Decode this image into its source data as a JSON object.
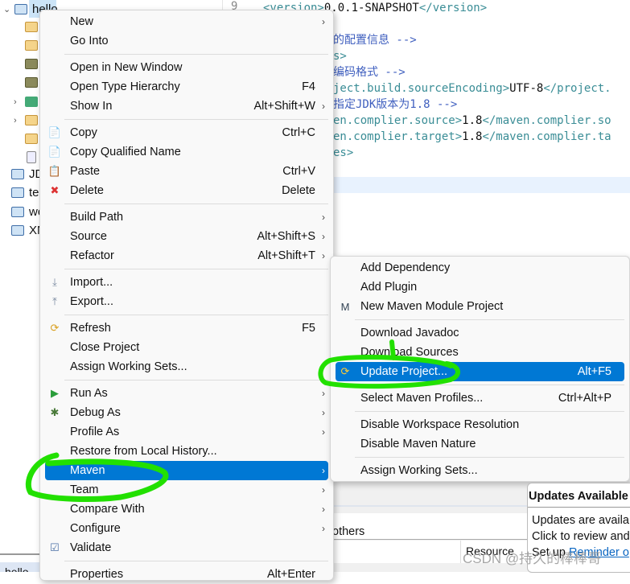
{
  "tree": {
    "items": [
      {
        "label": "hello",
        "selected": true
      },
      {
        "label": "JD"
      },
      {
        "label": "te"
      },
      {
        "label": "wo"
      },
      {
        "label": "XN"
      }
    ],
    "bottom_label": "hello"
  },
  "editor": {
    "line_number": "9",
    "lines": [
      {
        "parts": [
          [
            "tag",
            "<version>"
          ],
          [
            "txt",
            "0.0.1-SNAPSHOT"
          ],
          [
            "tag",
            "</version>"
          ]
        ]
      },
      {
        "parts": [
          [
            "cmt",
            "的配置信息 -->"
          ]
        ]
      },
      {
        "parts": [
          [
            "tag",
            "s>"
          ]
        ]
      },
      {
        "parts": [
          [
            "cmt",
            "  编码格式 -->"
          ]
        ]
      },
      {
        "parts": [
          [
            "tag",
            "ject.build.sourceEncoding>"
          ],
          [
            "txt",
            "UTF-8"
          ],
          [
            "tag",
            "</project."
          ]
        ]
      },
      {
        "parts": [
          [
            "cmt",
            "  指定JDK版本为1.8 -->"
          ]
        ]
      },
      {
        "parts": [
          [
            "tag",
            "en.complier.source>"
          ],
          [
            "txt",
            "1.8"
          ],
          [
            "tag",
            "</maven.complier.so"
          ]
        ]
      },
      {
        "parts": [
          [
            "tag",
            "en.complier.target>"
          ],
          [
            "txt",
            "1.8"
          ],
          [
            "tag",
            "</maven.complier.ta"
          ]
        ]
      },
      {
        "parts": [
          [
            "tag",
            "es>"
          ]
        ]
      }
    ]
  },
  "context_menu": {
    "items": [
      {
        "label": "New",
        "submenu": true
      },
      {
        "label": "Go Into"
      },
      {
        "sep": true
      },
      {
        "label": "Open in New Window"
      },
      {
        "label": "Open Type Hierarchy",
        "shortcut": "F4"
      },
      {
        "label": "Show In",
        "shortcut": "Alt+Shift+W",
        "submenu": true
      },
      {
        "sep": true
      },
      {
        "label": "Copy",
        "shortcut": "Ctrl+C",
        "icon": "copy-icon"
      },
      {
        "label": "Copy Qualified Name",
        "icon": "copy-qualified-name-icon"
      },
      {
        "label": "Paste",
        "shortcut": "Ctrl+V",
        "icon": "paste-icon"
      },
      {
        "label": "Delete",
        "shortcut": "Delete",
        "icon": "delete-icon"
      },
      {
        "sep": true
      },
      {
        "label": "Build Path",
        "submenu": true
      },
      {
        "label": "Source",
        "shortcut": "Alt+Shift+S",
        "submenu": true
      },
      {
        "label": "Refactor",
        "shortcut": "Alt+Shift+T",
        "submenu": true
      },
      {
        "sep": true
      },
      {
        "label": "Import...",
        "icon": "import-icon"
      },
      {
        "label": "Export...",
        "icon": "export-icon"
      },
      {
        "sep": true
      },
      {
        "label": "Refresh",
        "shortcut": "F5",
        "icon": "refresh-icon"
      },
      {
        "label": "Close Project"
      },
      {
        "label": "Assign Working Sets..."
      },
      {
        "sep": true
      },
      {
        "label": "Run As",
        "submenu": true,
        "icon": "run-icon"
      },
      {
        "label": "Debug As",
        "submenu": true,
        "icon": "debug-bug-icon"
      },
      {
        "label": "Profile As",
        "submenu": true
      },
      {
        "label": "Restore from Local History..."
      },
      {
        "label": "Maven",
        "submenu": true,
        "highlighted": true
      },
      {
        "label": "Team",
        "submenu": true
      },
      {
        "label": "Compare With",
        "submenu": true
      },
      {
        "label": "Configure",
        "submenu": true
      },
      {
        "label": "Validate",
        "icon": "checkbox-icon"
      },
      {
        "sep": true
      },
      {
        "label": "Properties",
        "shortcut": "Alt+Enter"
      }
    ]
  },
  "maven_submenu": {
    "items": [
      {
        "label": "Add Dependency"
      },
      {
        "label": "Add Plugin"
      },
      {
        "label": "New Maven Module Project",
        "icon": "maven-module-icon"
      },
      {
        "sep": true
      },
      {
        "label": "Download Javadoc"
      },
      {
        "label": "Download Sources"
      },
      {
        "label": "Update Project...",
        "shortcut": "Alt+F5",
        "highlighted": true,
        "icon": "maven-update-icon"
      },
      {
        "sep": true
      },
      {
        "label": "Select Maven Profiles...",
        "shortcut": "Ctrl+Alt+P"
      },
      {
        "sep": true
      },
      {
        "label": "Disable Workspace Resolution"
      },
      {
        "label": "Disable Maven Nature"
      },
      {
        "sep": true
      },
      {
        "label": "Assign Working Sets..."
      }
    ]
  },
  "bottom_panel": {
    "others": "others",
    "resource_header": "Resource"
  },
  "updates_popup": {
    "title": "Updates Available",
    "line1": "Updates are availa",
    "line2": "Click to review and",
    "line3_prefix": "Set up ",
    "line3_link": "Reminder o"
  },
  "watermark": "CSDN @持久的棒棒哥",
  "colors": {
    "highlight": "#0078d4",
    "annotation": "#22e000"
  }
}
